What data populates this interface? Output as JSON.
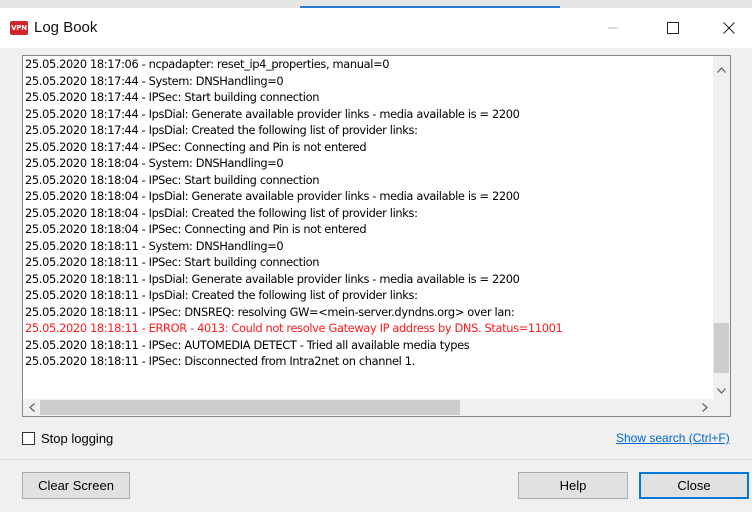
{
  "window": {
    "title": "Log Book",
    "app_icon_text": "VPN",
    "icons": [
      "minimize-icon",
      "maximize-icon",
      "close-icon"
    ]
  },
  "log": {
    "lines": [
      {
        "text": "25.05.2020 18:17:06 - ncpadapter: reset_ip4_properties, manual=0",
        "error": false
      },
      {
        "text": "25.05.2020 18:17:44 - System: DNSHandling=0",
        "error": false
      },
      {
        "text": "25.05.2020 18:17:44 - IPSec: Start building connection",
        "error": false
      },
      {
        "text": "25.05.2020 18:17:44 - IpsDial: Generate available provider links - media available is = 2200",
        "error": false
      },
      {
        "text": "25.05.2020 18:17:44 - IpsDial: Created the following list of provider links:",
        "error": false
      },
      {
        "text": "25.05.2020 18:17:44 - IPSec: Connecting and Pin is not entered",
        "error": false
      },
      {
        "text": "25.05.2020 18:18:04 - System: DNSHandling=0",
        "error": false
      },
      {
        "text": "25.05.2020 18:18:04 - IPSec: Start building connection",
        "error": false
      },
      {
        "text": "25.05.2020 18:18:04 - IpsDial: Generate available provider links - media available is = 2200",
        "error": false
      },
      {
        "text": "25.05.2020 18:18:04 - IpsDial: Created the following list of provider links:",
        "error": false
      },
      {
        "text": "25.05.2020 18:18:04 - IPSec: Connecting and Pin is not entered",
        "error": false
      },
      {
        "text": "25.05.2020 18:18:11 - System: DNSHandling=0",
        "error": false
      },
      {
        "text": "25.05.2020 18:18:11 - IPSec: Start building connection",
        "error": false
      },
      {
        "text": "25.05.2020 18:18:11 - IpsDial: Generate available provider links - media available is = 2200",
        "error": false
      },
      {
        "text": "25.05.2020 18:18:11 - IpsDial: Created the following list of provider links:",
        "error": false
      },
      {
        "text": "25.05.2020 18:18:11 - IPSec: DNSREQ: resolving GW=<mein-server.dyndns.org> over lan:",
        "error": false
      },
      {
        "text": "25.05.2020 18:18:11 - ERROR - 4013: Could not resolve Gateway IP address by DNS. Status=11001",
        "error": true
      },
      {
        "text": "25.05.2020 18:18:11 - IPSec: AUTOMEDIA DETECT - Tried all available media types",
        "error": false
      },
      {
        "text": "25.05.2020 18:18:11 - IPSec: Disconnected from Intra2net on channel 1.",
        "error": false
      }
    ],
    "error_color": "#ff1a1a"
  },
  "options": {
    "stop_logging_label": "Stop logging",
    "stop_logging_checked": false,
    "search_link": "Show search (Ctrl+F)"
  },
  "buttons": {
    "clear": "Clear Screen",
    "help": "Help",
    "close": "Close"
  }
}
